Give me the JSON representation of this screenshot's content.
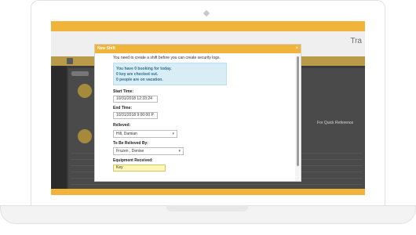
{
  "app": {
    "brand": "Tra",
    "quick_reference": "For Quick Reference"
  },
  "modal": {
    "title": "New Shift",
    "close_symbol": "×",
    "intro": "You need to create a shift before you can create security logs.",
    "alert": {
      "lines": [
        "You have 0 booking for today.",
        "0 key are checked out.",
        "0 people are on vacation."
      ]
    },
    "start_time": {
      "label": "Start Time:",
      "value": "10/31/2018 12:33:24"
    },
    "end_time": {
      "label": "End Time:",
      "value": "10/31/2018 9:00:00 P"
    },
    "relieved": {
      "label": "Relieved:",
      "value": "Hill, Damian"
    },
    "to_be_relieved_by": {
      "label": "To Be Relieved By:",
      "value": "Fruzen , Denise"
    },
    "equipment_received": {
      "label": "Equipment Received:",
      "value": "Key"
    }
  }
}
